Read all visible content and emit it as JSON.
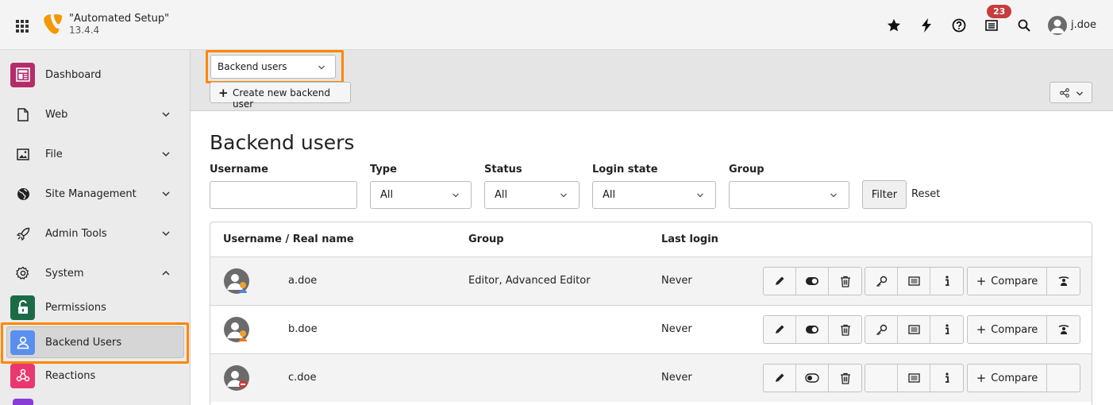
{
  "topbar": {
    "site_name": "\"Automated Setup\"",
    "version": "13.4.4",
    "notification_count": "23",
    "user": "j.doe"
  },
  "sidebar": {
    "items": [
      {
        "label": "Dashboard",
        "icon": "dashboard-icon",
        "color": "#b42d69"
      },
      {
        "label": "Web",
        "icon": "page-icon",
        "chevron": "down"
      },
      {
        "label": "File",
        "icon": "image-icon",
        "chevron": "down"
      },
      {
        "label": "Site Management",
        "icon": "globe-icon",
        "chevron": "down"
      },
      {
        "label": "Admin Tools",
        "icon": "rocket-icon",
        "chevron": "down"
      },
      {
        "label": "System",
        "icon": "gear-icon",
        "chevron": "up"
      },
      {
        "label": "Permissions",
        "icon": "unlock-icon",
        "color": "#1b6b47"
      },
      {
        "label": "Backend Users",
        "icon": "user-icon",
        "color": "#5a8ff0",
        "active": true
      },
      {
        "label": "Reactions",
        "icon": "webhook-icon",
        "color": "#e8386f"
      }
    ]
  },
  "module": {
    "menu_value": "Backend users",
    "create_label": "Create new backend user"
  },
  "page": {
    "title": "Backend users"
  },
  "filters": {
    "username_label": "Username",
    "username_value": "",
    "type_label": "Type",
    "type_value": "All",
    "status_label": "Status",
    "status_value": "All",
    "login_state_label": "Login state",
    "login_state_value": "All",
    "group_label": "Group",
    "group_value": "",
    "filter_button": "Filter",
    "reset_link": "Reset"
  },
  "table": {
    "headers": [
      "Username / Real name",
      "Group",
      "Last login"
    ],
    "compare_label": "Compare",
    "rows": [
      {
        "username": "a.doe",
        "group": "Editor, Advanced Editor",
        "last_login": "Never",
        "status": "active-admin"
      },
      {
        "username": "b.doe",
        "group": "",
        "last_login": "Never",
        "status": "active"
      },
      {
        "username": "c.doe",
        "group": "",
        "last_login": "Never",
        "status": "disabled"
      }
    ]
  },
  "colors": {
    "highlight": "#ff8700",
    "badge": "#c83c3c",
    "typo3_orange": "#f49700"
  }
}
